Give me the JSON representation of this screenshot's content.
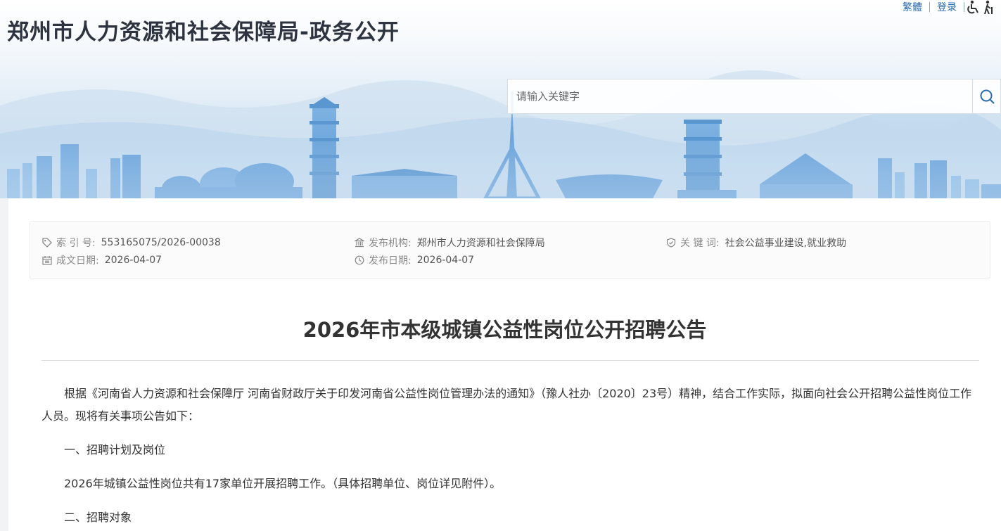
{
  "header": {
    "site_title": "郑州市人力资源和社会保障局-政务公开",
    "links": {
      "traditional": "繁體",
      "login": "登录"
    },
    "icons": [
      "accessibility-icon",
      "elder-mode-icon"
    ],
    "search": {
      "placeholder": "请输入关键字",
      "button_icon": "search-icon"
    }
  },
  "meta": {
    "index_no": {
      "label": "索 引 号:",
      "value": "553165075/2026-00038"
    },
    "publisher": {
      "label": "发布机构:",
      "value": "郑州市人力资源和社会保障局"
    },
    "keywords": {
      "label": "关 键 词:",
      "value": "社会公益事业建设,就业救助"
    },
    "doc_date": {
      "label": "成文日期:",
      "value": "2026-04-07"
    },
    "pub_date": {
      "label": "发布日期:",
      "value": "2026-04-07"
    }
  },
  "article": {
    "title": "2026年市本级城镇公益性岗位公开招聘公告",
    "paragraphs": [
      "根据《河南省人力资源和社会保障厅 河南省财政厅关于印发河南省公益性岗位管理办法的通知》（豫人社办〔2020〕23号）精神，结合工作实际，拟面向社会公开招聘公益性岗位工作人员。现将有关事项公告如下：",
      "一、招聘计划及岗位",
      "2026年城镇公益性岗位共有17家单位开展招聘工作。（具体招聘单位、岗位详见附件）。",
      "二、招聘对象"
    ]
  },
  "colors": {
    "title_text": "#2d3440",
    "link": "#2b6cb0",
    "skyline": "#6fa8dc",
    "body_text": "#333333"
  }
}
